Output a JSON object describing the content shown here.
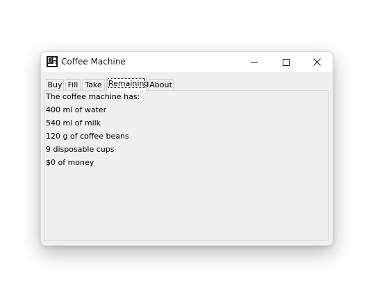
{
  "window": {
    "title": "Coffee Machine",
    "icon": "coffee-machine-app-icon"
  },
  "titlebar_buttons": {
    "minimize": "minimize-icon",
    "maximize": "maximize-icon",
    "close": "close-icon"
  },
  "tabs": [
    {
      "label": "Buy",
      "selected": false
    },
    {
      "label": "Fill",
      "selected": false
    },
    {
      "label": "Take",
      "selected": false
    },
    {
      "label": "Remaining",
      "selected": true
    },
    {
      "label": "About",
      "selected": false
    }
  ],
  "remaining_panel": {
    "heading": "The coffee machine has:",
    "lines": [
      "400 ml of water",
      "540 ml of milk",
      "120 g of coffee beans",
      "9 disposable cups",
      "$0 of money"
    ]
  }
}
